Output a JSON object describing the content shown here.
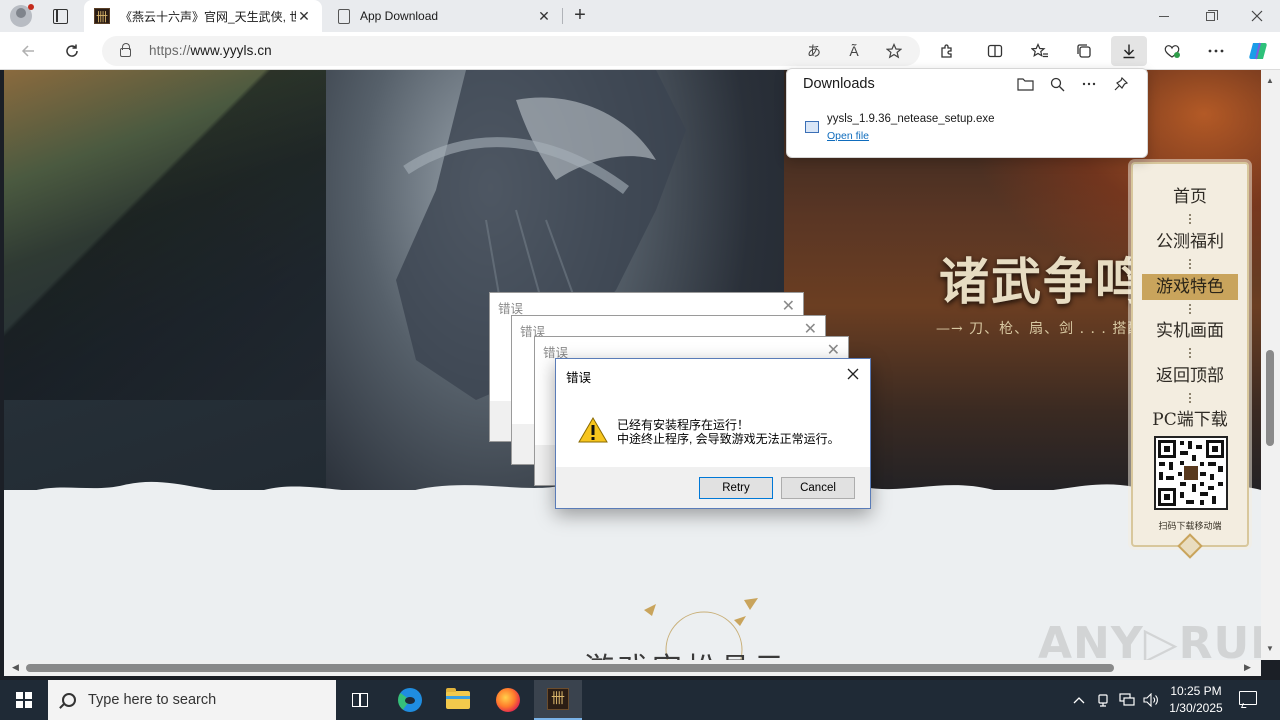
{
  "browser": {
    "tabs": [
      {
        "title": "《燕云十六声》官网_天生武侠, 世",
        "close": "✕"
      },
      {
        "title": "App Download",
        "close": "✕"
      }
    ],
    "new_tab": "+",
    "address": {
      "protocol": "https://",
      "host": "www.yyyls.cn"
    },
    "toolbar_icons": [
      "back-icon",
      "refresh-icon",
      "lock-icon",
      "translate-icon",
      "read-aloud-icon",
      "favorite-star-icon",
      "extensions-icon",
      "split-screen-icon",
      "favorites-icon",
      "collections-icon",
      "downloads-icon",
      "browser-essentials-icon",
      "more-icon",
      "copilot-icon"
    ],
    "read_aloud_label": "Ã",
    "translate_label": "あ"
  },
  "downloads": {
    "title": "Downloads",
    "file_name": "yysls_1.9.36_netease_setup.exe",
    "open_link": "Open file"
  },
  "page": {
    "hero_title": "诸武争鸣,",
    "hero_sub": "—→ 刀、枪、扇、剑 . . . 搭配十",
    "nav_items": [
      "首页",
      "公测福利",
      "游戏特色",
      "实机画面",
      "返回顶部",
      "PC端下载"
    ],
    "active_nav_index": 2,
    "qr_caption": "扫码下载移动端",
    "section_heading": "游戏定松具示",
    "watermark": "ANY▷RUN"
  },
  "dialogs": {
    "background_titles": [
      "错误",
      "错误",
      "错误"
    ],
    "main": {
      "title": "错误",
      "message_line1": "已经有安装程序在运行！",
      "message_line2": "中途终止程序, 会导致游戏无法正常运行。",
      "retry": "Retry",
      "cancel": "Cancel"
    }
  },
  "taskbar": {
    "search_placeholder": "Type here to search",
    "time": "10:25 PM",
    "date": "1/30/2025",
    "pinned": [
      "task-view-icon",
      "edge-icon",
      "file-explorer-icon",
      "firefox-icon",
      "yysls-installer-icon"
    ],
    "tray": [
      "chevron-up-icon",
      "network-device-icon",
      "network-icon",
      "volume-icon"
    ]
  }
}
